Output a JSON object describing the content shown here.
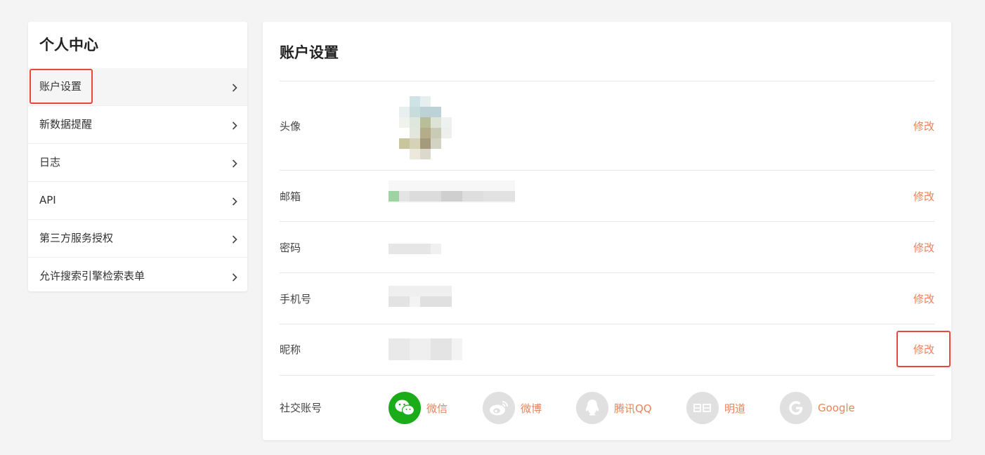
{
  "sidebar": {
    "title": "个人中心",
    "items": [
      {
        "label": "账户设置",
        "active": true
      },
      {
        "label": "新数据提醒"
      },
      {
        "label": "日志"
      },
      {
        "label": "API"
      },
      {
        "label": "第三方服务授权"
      },
      {
        "label": "允许搜索引擎检索表单"
      }
    ]
  },
  "main": {
    "title": "账户设置",
    "rows": [
      {
        "label": "头像",
        "action": "修改"
      },
      {
        "label": "邮箱",
        "action": "修改"
      },
      {
        "label": "密码",
        "action": "修改"
      },
      {
        "label": "手机号",
        "action": "修改"
      },
      {
        "label": "昵称",
        "action": "修改"
      }
    ],
    "social": {
      "label": "社交账号",
      "accounts": [
        {
          "name": "微信",
          "icon": "wechat-icon",
          "color": "#1aad19"
        },
        {
          "name": "微博",
          "icon": "weibo-icon",
          "color": "#e0e0e0"
        },
        {
          "name": "腾讯QQ",
          "icon": "qq-icon",
          "color": "#e0e0e0"
        },
        {
          "name": "明道",
          "icon": "mingdao-icon",
          "color": "#e0e0e0"
        },
        {
          "name": "Google",
          "icon": "google-icon",
          "color": "#e0e0e0"
        }
      ]
    }
  },
  "colors": {
    "accent": "#e8835a",
    "highlight": "#e34a3c",
    "wechat": "#1aad19"
  }
}
